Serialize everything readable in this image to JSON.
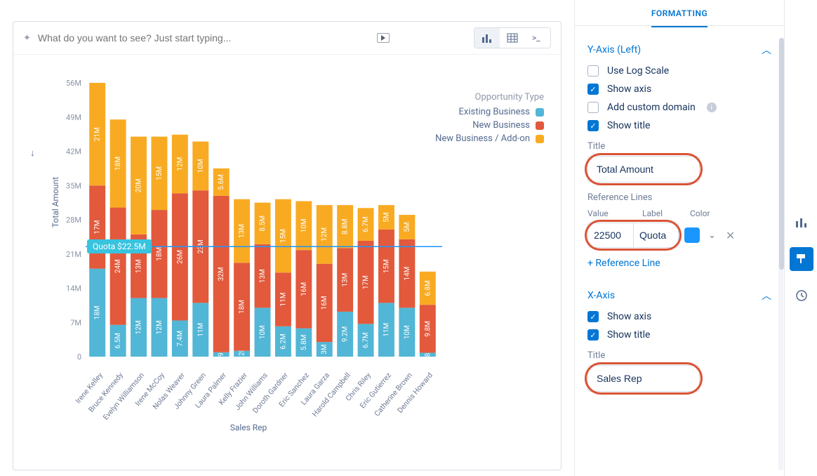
{
  "toolbar": {
    "nlq_placeholder": "What do you want to see? Just start typing..."
  },
  "legend": {
    "title": "Opportunity Type",
    "items": [
      {
        "label": "Existing Business",
        "color": "#52b6d6"
      },
      {
        "label": "New Business",
        "color": "#e2593c"
      },
      {
        "label": "New Business / Add-on",
        "color": "#f8ab22"
      }
    ]
  },
  "y_axis": {
    "label": "Total Amount",
    "ticks": [
      "0",
      "7M",
      "14M",
      "21M",
      "28M",
      "35M",
      "42M",
      "49M",
      "56M"
    ]
  },
  "x_axis": {
    "label": "Sales Rep"
  },
  "reference_line": {
    "label": "Quota $22.5M",
    "value": 22.5
  },
  "panel": {
    "tab": "FORMATTING",
    "y_section": "Y-Axis (Left)",
    "x_section": "X-Axis",
    "use_log_label": "Use Log Scale",
    "show_axis_label": "Show axis",
    "add_domain_label": "Add custom domain",
    "show_title_label": "Show title",
    "title_label": "Title",
    "y_title_value": "Total Amount",
    "x_title_value": "Sales Rep",
    "ref_section": "Reference Lines",
    "ref_value_label": "Value",
    "ref_label_label": "Label",
    "ref_color_label": "Color",
    "ref_value": "22500",
    "ref_label": "Quota",
    "add_ref": "+ Reference Line"
  },
  "chart_data": {
    "type": "bar",
    "title": "",
    "xlabel": "Sales Rep",
    "ylabel": "Total Amount",
    "ylim": [
      0,
      56
    ],
    "unit": "M",
    "reference_lines": [
      {
        "label": "Quota $22.5M",
        "value": 22.5
      }
    ],
    "categories": [
      "Irene Kelley",
      "Bruce Kennedy",
      "Evelyn Williamson",
      "Irene McCoy",
      "Nolas Weaver",
      "Johnny Green",
      "Laura Palmer",
      "Kelly Frazier",
      "John Williams",
      "Doroth Gardner",
      "Eric Sanchez",
      "Laura Garza",
      "Harold Campbell",
      "Chris Riley",
      "Eric Gutierrez",
      "Catherine Brown",
      "Dennis Howard"
    ],
    "series": [
      {
        "name": "Existing Business",
        "color": "#52b6d6",
        "values": [
          18,
          6.5,
          12,
          12,
          7.4,
          11,
          0.9,
          1.2,
          10,
          6.2,
          5.8,
          3,
          9.2,
          6.7,
          11,
          10,
          0.8
        ]
      },
      {
        "name": "New Business",
        "color": "#e2593c",
        "values": [
          17,
          24,
          13,
          18,
          26,
          23,
          32,
          18,
          13,
          11,
          16,
          16,
          13,
          17,
          15,
          14,
          9.8
        ]
      },
      {
        "name": "New Business / Add-on",
        "color": "#f8ab22",
        "values": [
          21,
          18,
          20,
          15,
          12,
          10,
          5.6,
          13,
          8.5,
          15,
          10,
          12,
          8.8,
          6.7,
          5,
          5,
          6.8
        ]
      }
    ]
  }
}
